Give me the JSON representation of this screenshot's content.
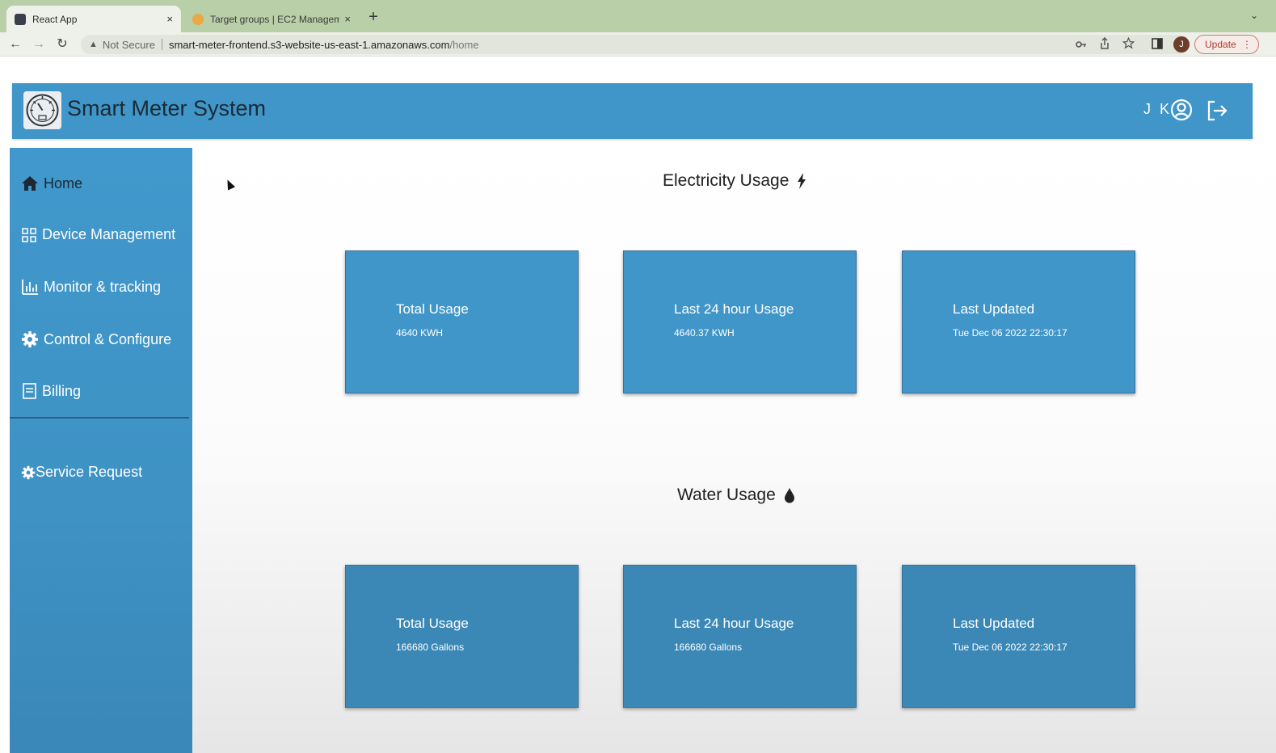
{
  "browser": {
    "tabs": [
      {
        "title": "React App",
        "close": "×"
      },
      {
        "title": "Target groups | EC2 Managem",
        "close": "×"
      }
    ],
    "new_tab": "+",
    "tab_menu": "⌄",
    "nav": {
      "back": "←",
      "forward": "→",
      "reload": "↻"
    },
    "address": {
      "warning": "▲",
      "security": "Not Secure",
      "host": "smart-meter-frontend.s3-website-us-east-1.amazonaws.com",
      "path": "/home"
    },
    "profile_initial": "J",
    "update_label": "Update",
    "update_menu": "⋮"
  },
  "app": {
    "title": "Smart Meter System",
    "user_initials": "J K"
  },
  "sidebar": {
    "items": [
      {
        "label": "Home",
        "icon": "home-icon"
      },
      {
        "label": "Device Management",
        "icon": "grid-icon"
      },
      {
        "label": "Monitor & tracking",
        "icon": "bar-chart-icon"
      },
      {
        "label": "Control & Configure",
        "icon": "gear-icon"
      },
      {
        "label": "Billing",
        "icon": "document-icon"
      },
      {
        "label": "Service Request",
        "icon": "gear-icon"
      }
    ]
  },
  "electricity": {
    "title": "Electricity Usage",
    "cards": [
      {
        "label": "Total Usage",
        "value": "4640 KWH"
      },
      {
        "label": "Last 24 hour Usage",
        "value": "4640.37 KWH"
      },
      {
        "label": "Last Updated",
        "value": "Tue Dec 06 2022 22:30:17"
      }
    ]
  },
  "water": {
    "title": "Water Usage",
    "cards": [
      {
        "label": "Total Usage",
        "value": "166680 Gallons"
      },
      {
        "label": "Last 24 hour Usage",
        "value": "166680 Gallons"
      },
      {
        "label": "Last Updated",
        "value": "Tue Dec 06 2022 22:30:17"
      }
    ]
  },
  "colors": {
    "header_blue": "#4096c9",
    "sidebar_blue": "#4198cc",
    "card_blue": "#4096c9"
  }
}
